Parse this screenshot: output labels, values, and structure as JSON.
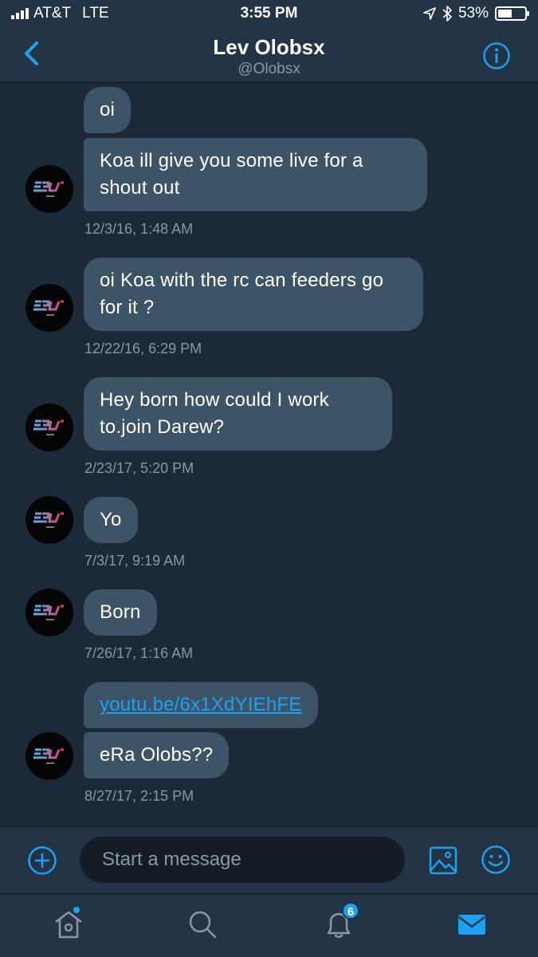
{
  "status_bar": {
    "carrier": "AT&T",
    "network": "LTE",
    "time": "3:55 PM",
    "battery_percent": "53%",
    "battery_level": 0.53
  },
  "header": {
    "name": "Lev Olobsx",
    "handle": "@Olobsx",
    "back_icon": "chevron-left-icon",
    "info_icon": "info-icon"
  },
  "messages": [
    {
      "text": "oi"
    },
    {
      "text": "Koa ill give you some live for a shout out"
    },
    {
      "timestamp": "12/3/16, 1:48 AM"
    },
    {
      "text": "oi Koa with the rc can feeders go for it ?"
    },
    {
      "timestamp": "12/22/16, 6:29 PM"
    },
    {
      "text": "Hey born how could I work to.join Darew?"
    },
    {
      "timestamp": "2/23/17, 5:20 PM"
    },
    {
      "text": "Yo"
    },
    {
      "timestamp": "7/3/17, 9:19 AM"
    },
    {
      "text": "Born"
    },
    {
      "timestamp": "7/26/17, 1:16 AM"
    },
    {
      "text": "youtu.be/6x1XdYIEhFE"
    },
    {
      "text": "eRa Olobs??"
    },
    {
      "timestamp": "8/27/17, 2:15 PM"
    }
  ],
  "composer": {
    "placeholder": "Start a message"
  },
  "tabbar": {
    "notifications_count": "6"
  },
  "colors": {
    "background": "#1c2938",
    "bar": "#243447",
    "bubble": "#3d5466",
    "accent": "#1da1f2",
    "muted": "#8899a6"
  }
}
